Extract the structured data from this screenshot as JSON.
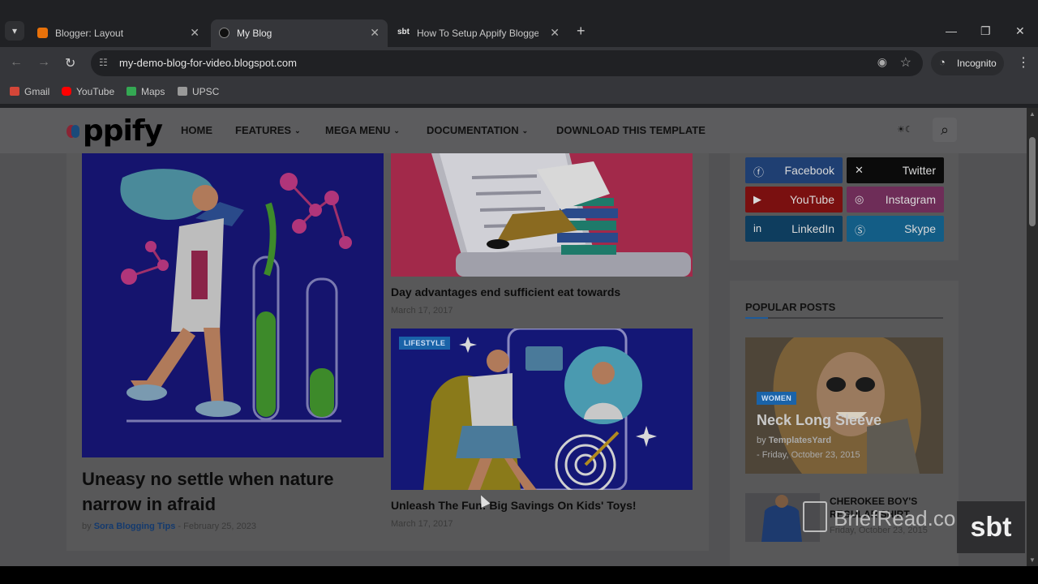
{
  "browser": {
    "tabs": [
      {
        "title": "Blogger: Layout",
        "favicon": "blogger-icon",
        "active": false
      },
      {
        "title": "My Blog",
        "favicon": "blog-icon",
        "active": true
      },
      {
        "title": "How To Setup Appify Blogger T",
        "favicon": "sbt-icon",
        "active": false
      }
    ],
    "favicon_text": "sbt",
    "url": "my-demo-blog-for-video.blogspot.com",
    "incognito_label": "Incognito",
    "bookmarks": [
      {
        "label": "Gmail",
        "icon": "gmail-icon",
        "color": "#d44638"
      },
      {
        "label": "YouTube",
        "icon": "youtube-icon",
        "color": "#ff0000"
      },
      {
        "label": "Maps",
        "icon": "maps-icon",
        "color": "#34a853"
      },
      {
        "label": "UPSC",
        "icon": "upsc-icon",
        "color": "#999999"
      }
    ]
  },
  "site": {
    "logo_text": "ppify",
    "menu": [
      {
        "label": "HOME",
        "dropdown": false
      },
      {
        "label": "FEATURES",
        "dropdown": true
      },
      {
        "label": "MEGA MENU",
        "dropdown": true
      },
      {
        "label": "DOCUMENTATION",
        "dropdown": true
      },
      {
        "label": "DOWNLOAD THIS TEMPLATE",
        "dropdown": false
      }
    ],
    "mode_toggle": "☀☾"
  },
  "posts": {
    "main": {
      "title": "Uneasy no settle when nature narrow in afraid",
      "by": "by",
      "author": "Sora Blogging Tips",
      "date": "- February 25, 2023"
    },
    "side": [
      {
        "title": "Day advantages end sufficient eat towards",
        "date": "March 17, 2017",
        "tag": ""
      },
      {
        "title": "Unleash The Fun: Big Savings On Kids' Toys!",
        "date": "March 17, 2017",
        "tag": "LIFESTYLE"
      }
    ]
  },
  "social": [
    {
      "label": "Facebook",
      "icon": "facebook-icon",
      "color": "#1f3f72"
    },
    {
      "label": "Twitter",
      "icon": "x-twitter-icon",
      "color": "#0b0b0b"
    },
    {
      "label": "YouTube",
      "icon": "youtube-icon",
      "color": "#7a1010"
    },
    {
      "label": "Instagram",
      "icon": "instagram-icon",
      "color": "#6e2d58"
    },
    {
      "label": "LinkedIn",
      "icon": "linkedin-icon",
      "color": "#0e3d5e"
    },
    {
      "label": "Skype",
      "icon": "skype-icon",
      "color": "#135d86"
    }
  ],
  "popular": {
    "heading": "POPULAR POSTS",
    "feature": {
      "tag": "WOMEN",
      "title": "Neck Long Sleeve",
      "by": "by",
      "author": "TemplatesYard",
      "date": "- Friday, October 23, 2015"
    },
    "item": {
      "title": "CHEROKEE BOY'S REGULAR SHIRT",
      "date": "Friday, October 23, 2015"
    }
  },
  "watermarks": {
    "brief": "BriefRead.com",
    "sbt": "sbt"
  }
}
